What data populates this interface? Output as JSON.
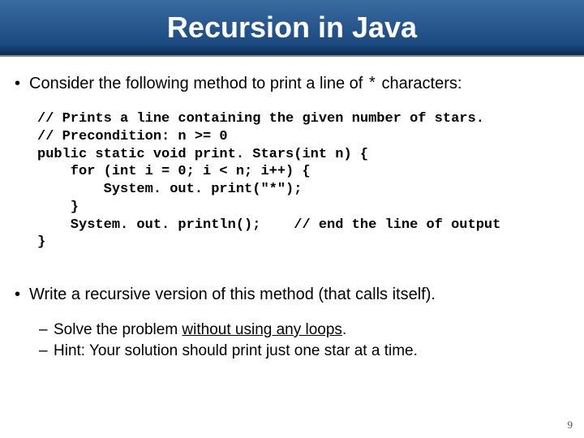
{
  "title": "Recursion in Java",
  "bullet1_prefix": "Consider the following method to print a line of ",
  "bullet1_mono": "*",
  "bullet1_suffix": " characters:",
  "code": "// Prints a line containing the given number of stars.\n// Precondition: n >= 0\npublic static void print. Stars(int n) {\n    for (int i = 0; i < n; i++) {\n        System. out. print(\"*\");\n    }\n    System. out. println();    // end the line of output\n}",
  "bullet2": "Write a recursive version of this method (that calls itself).",
  "sub1_prefix": "Solve the problem ",
  "sub1_underline": "without using any loops",
  "sub1_suffix": ".",
  "sub2": "Hint: Your solution should print just one star at a time.",
  "page": "9"
}
